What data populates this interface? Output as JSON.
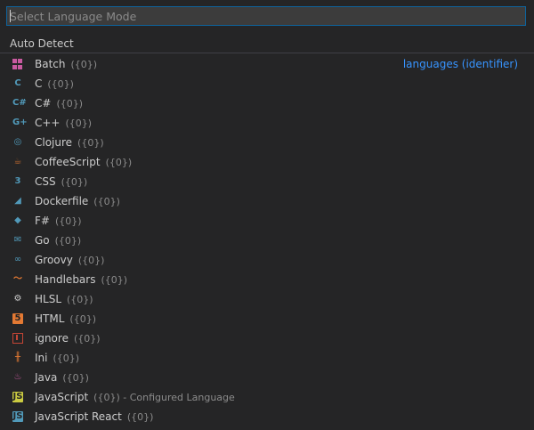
{
  "search": {
    "placeholder": "Select Language Mode",
    "value": ""
  },
  "auto_detect_label": "Auto Detect",
  "languages": [
    {
      "label": "Batch",
      "desc": "({0})",
      "detail": "languages (identifier)",
      "icon": "windows-icon",
      "color": "#c95aa0"
    },
    {
      "label": "C",
      "desc": "({0})",
      "icon": "c-icon",
      "glyph": "C",
      "color": "#519aba"
    },
    {
      "label": "C#",
      "desc": "({0})",
      "icon": "csharp-icon",
      "glyph": "C#",
      "color": "#519aba"
    },
    {
      "label": "C++",
      "desc": "({0})",
      "icon": "cpp-icon",
      "glyph": "G+",
      "color": "#519aba"
    },
    {
      "label": "Clojure",
      "desc": "({0})",
      "icon": "clojure-icon",
      "glyph": "◎",
      "color": "#519aba"
    },
    {
      "label": "CoffeeScript",
      "desc": "({0})",
      "icon": "coffee-icon",
      "glyph": "☕",
      "color": "#c06a2f"
    },
    {
      "label": "CSS",
      "desc": "({0})",
      "icon": "css-icon",
      "glyph": "3",
      "color": "#519aba"
    },
    {
      "label": "Dockerfile",
      "desc": "({0})",
      "icon": "docker-icon",
      "glyph": "◢",
      "color": "#519aba"
    },
    {
      "label": "F#",
      "desc": "({0})",
      "icon": "fsharp-icon",
      "glyph": "◆",
      "color": "#519aba"
    },
    {
      "label": "Go",
      "desc": "({0})",
      "icon": "go-icon",
      "glyph": "✉",
      "color": "#519aba"
    },
    {
      "label": "Groovy",
      "desc": "({0})",
      "icon": "groovy-icon",
      "glyph": "∞",
      "color": "#519aba"
    },
    {
      "label": "Handlebars",
      "desc": "({0})",
      "icon": "handlebars-icon",
      "glyph": "〜",
      "color": "#e37933"
    },
    {
      "label": "HLSL",
      "desc": "({0})",
      "icon": "gear-icon",
      "glyph": "⚙",
      "color": "#cccccc"
    },
    {
      "label": "HTML",
      "desc": "({0})",
      "icon": "html5-icon",
      "glyph": "5",
      "color": "#e37933"
    },
    {
      "label": "ignore",
      "desc": "({0})",
      "icon": "ignore-icon",
      "color": "#c44535"
    },
    {
      "label": "Ini",
      "desc": "({0})",
      "icon": "ini-icon",
      "glyph": "╫",
      "color": "#e37933"
    },
    {
      "label": "Java",
      "desc": "({0})",
      "icon": "java-icon",
      "glyph": "♨",
      "color": "#c95aa0"
    },
    {
      "label": "JavaScript",
      "desc": "({0}) - Configured Language",
      "icon": "javascript-icon",
      "glyph": "JS",
      "color": "#cbcb41"
    },
    {
      "label": "JavaScript React",
      "desc": "({0})",
      "icon": "javascript-react-icon",
      "glyph": "JS",
      "color": "#519aba"
    }
  ]
}
